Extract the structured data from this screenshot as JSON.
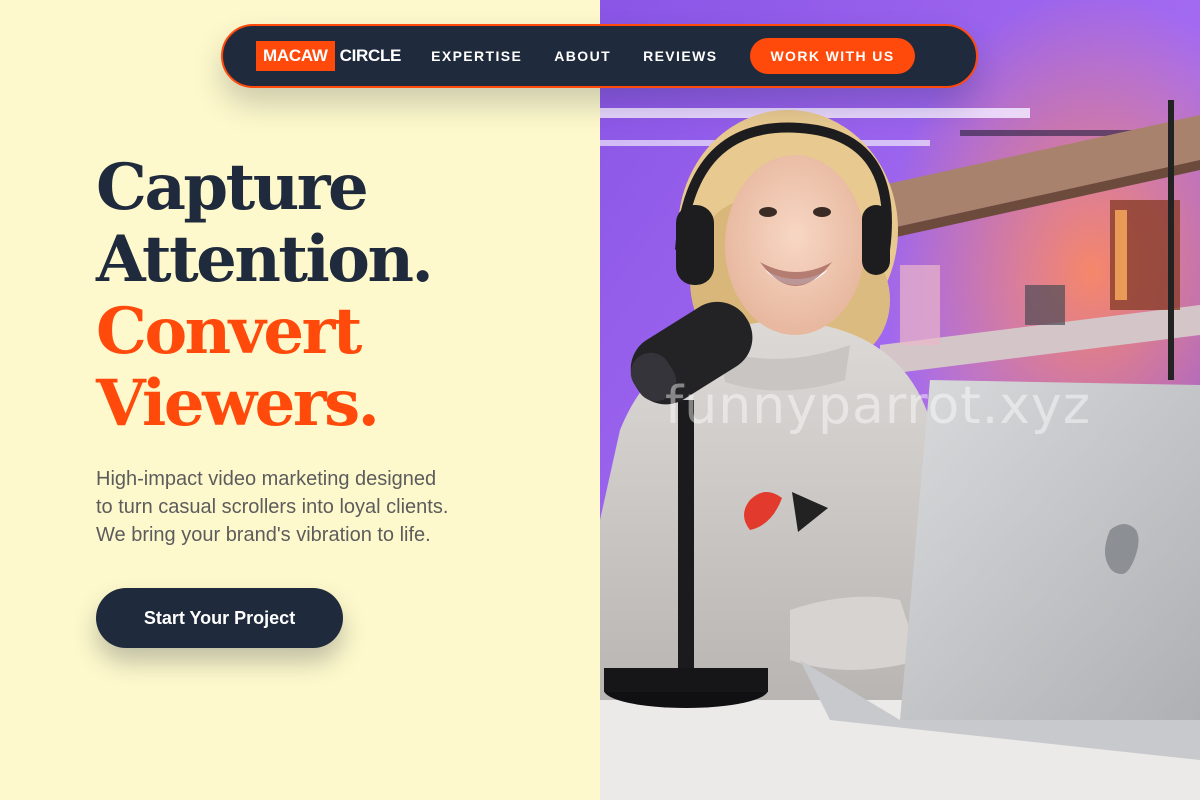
{
  "brand": {
    "logo_box": "MACAW",
    "logo_text": "CIRCLE",
    "accent_color": "#ff4a0c",
    "dark_color": "#1f2a3d",
    "background_color": "#fef9cc"
  },
  "nav": {
    "links": [
      "EXPERTISE",
      "ABOUT",
      "REVIEWS"
    ],
    "cta_label": "WORK WITH US"
  },
  "hero": {
    "headline": [
      "Capture",
      "Attention.",
      "Convert",
      "Viewers."
    ],
    "subtext": [
      "High-impact video marketing designed",
      "to turn casual scrollers into loyal clients.",
      "We bring your brand's vibration to life."
    ],
    "cta_label": "Start Your Project"
  },
  "photo": {
    "watermark": "funnyparrot.xyz"
  }
}
